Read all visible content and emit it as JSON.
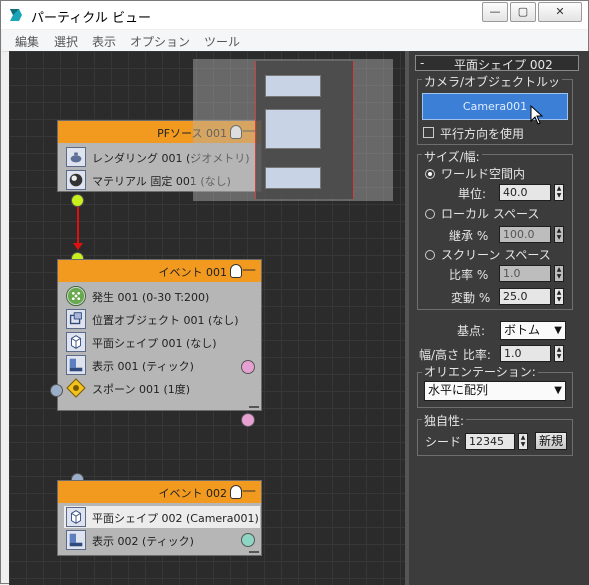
{
  "window": {
    "title": "パーティクル ビュー",
    "min": "—",
    "max": "▢",
    "close": "✕"
  },
  "menu": [
    "編集",
    "選択",
    "表示",
    "オプション",
    "ツール"
  ],
  "nodes": {
    "pf_source": {
      "title": "PFソース 001",
      "ops": [
        {
          "label": "レンダリング 001 (ジオメトリ)",
          "icon": "render-teapot-icon"
        },
        {
          "label": "マテリアル 固定 001 (なし)",
          "icon": "material-sphere-icon"
        }
      ]
    },
    "event1": {
      "title": "イベント 001",
      "ops": [
        {
          "label": "発生 001 (0-30 T:200)",
          "icon": "birth-icon"
        },
        {
          "label": "位置オブジェクト 001 (なし)",
          "icon": "position-object-icon"
        },
        {
          "label": "平面シェイプ 001 (なし)",
          "icon": "shape-facing-icon"
        },
        {
          "label": "表示 001 (ティック)",
          "icon": "display-icon"
        },
        {
          "label": "スポーン 001 (1度)",
          "icon": "spawn-icon"
        }
      ]
    },
    "event2": {
      "title": "イベント 002",
      "ops": [
        {
          "label": "平面シェイプ 002 (Camera001)",
          "icon": "shape-facing-icon"
        },
        {
          "label": "表示 002 (ティック)",
          "icon": "display-icon"
        }
      ]
    }
  },
  "colors": {
    "node_header": "#f29a1f",
    "connector_lime": "#c8f01e",
    "link_red": "#e01010",
    "display_pink": "#e6a0d2",
    "display_teal": "#8ed6c4",
    "camera_button": "#3c7fd6"
  },
  "panel": {
    "collapse": "-",
    "rollout_title": "平面シェイプ 002",
    "camera_group_label": "カメラ/オブジェクトルッ",
    "camera_button": "Camera001",
    "parallel_label": "平行方向を使用",
    "size_group_label": "サイズ/幅:",
    "world_space": "ワールド空間内",
    "units_label": "単位:",
    "units_value": "40.0",
    "local_space": "ローカル スペース",
    "inherit_label": "継承 %",
    "inherit_value": "100.0",
    "screen_space": "スクリーン スペース",
    "proportion_label": "比率 %",
    "proportion_value": "1.0",
    "variation_label": "変動 %",
    "variation_value": "25.0",
    "pivot_label": "基点:",
    "pivot_value": "ボトム",
    "ratio_label": "幅/高さ 比率:",
    "ratio_value": "1.0",
    "orientation_group_label": "オリエンテーション:",
    "orientation_value": "水平に配列",
    "uniqueness_group_label": "独自性:",
    "seed_label": "シード",
    "seed_value": "12345",
    "new_button": "新規"
  }
}
